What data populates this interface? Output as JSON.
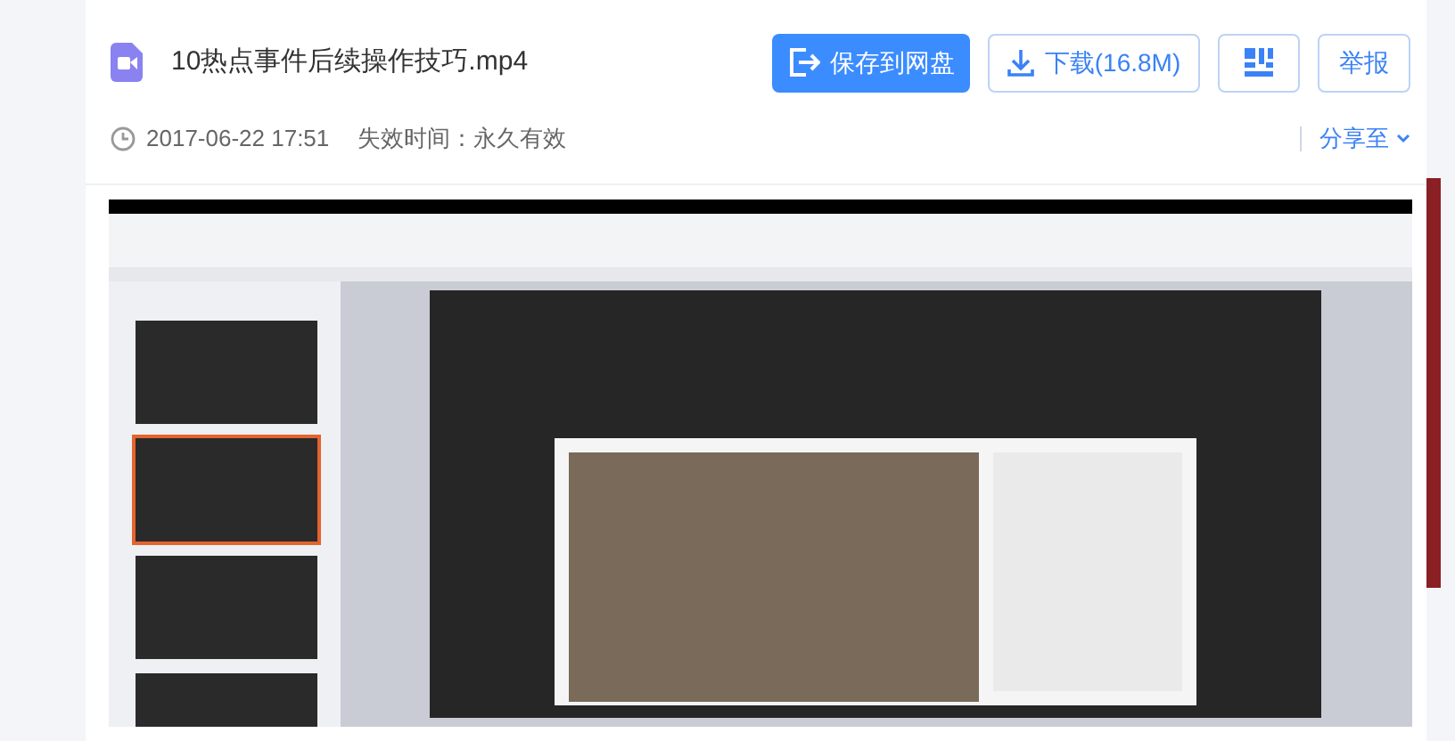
{
  "file": {
    "name": "10热点事件后续操作技巧.mp4",
    "date": "2017-06-22 17:51",
    "expiry": "失效时间：永久有效"
  },
  "actions": [
    {
      "kind": "primary",
      "label": "保存到网盘"
    },
    {
      "kind": "download",
      "label": "下载(16.8M)"
    },
    {
      "kind": "qr"
    },
    {
      "kind": "plain",
      "label": "举报"
    }
  ],
  "share": {
    "label": "分享至"
  }
}
